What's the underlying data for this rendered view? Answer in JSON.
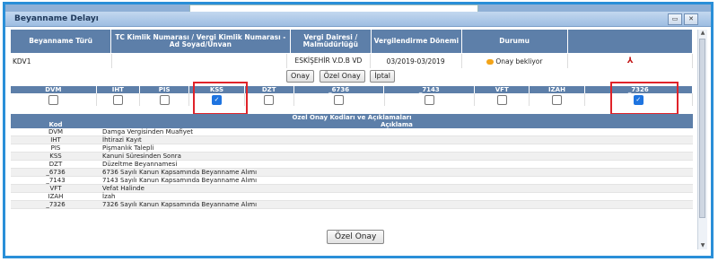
{
  "window": {
    "title": "Beyanname Delayı",
    "btn_min": "▭",
    "btn_close": "✕"
  },
  "header_cols": [
    "Beyanname Türü",
    "TC Kimlik Numarası / Vergi Kimlik Numarası - Ad Soyad/Unvan",
    "Vergi Dairesi / Malmüdürlüğü",
    "Vergilendirme Dönemi",
    "Durumu",
    ""
  ],
  "row": {
    "tur": "KDV1",
    "kimlik": "",
    "daire": "ESKİŞEHİR V.D.B VD",
    "donem": "03/2019-03/2019",
    "durum": "Onay bekliyor"
  },
  "actions": {
    "onay": "Onay",
    "ozel_onay": "Özel Onay",
    "iptal": "İptal"
  },
  "codes_header": [
    "DVM",
    "IHT",
    "PIS",
    "KSS",
    "DZT",
    "_6736",
    "_7143",
    "VFT",
    "IZAH",
    "_7326"
  ],
  "checked": [
    false,
    false,
    false,
    true,
    false,
    false,
    false,
    false,
    false,
    true
  ],
  "codes_table_title": "Özel Onay Kodları ve Açıklamaları",
  "codes_col_kod": "Kod",
  "codes_col_aciklama": "Açıklama",
  "codes": [
    {
      "kod": "DVM",
      "aciklama": "Damga Vergisinden Muafiyet"
    },
    {
      "kod": "IHT",
      "aciklama": "İhtirazi Kayıt"
    },
    {
      "kod": "PIS",
      "aciklama": "Pişmanlık Talepli"
    },
    {
      "kod": "KSS",
      "aciklama": "Kanuni Süresinden Sonra"
    },
    {
      "kod": "DZT",
      "aciklama": "Düzeltme Beyannamesi"
    },
    {
      "kod": "_6736",
      "aciklama": "6736 Sayılı Kanun Kapsamında Beyanname Alımı"
    },
    {
      "kod": "_7143",
      "aciklama": "7143 Sayılı Kanun Kapsamında Beyanname Alımı"
    },
    {
      "kod": "VFT",
      "aciklama": "Vefat Halinde"
    },
    {
      "kod": "IZAH",
      "aciklama": "İzah"
    },
    {
      "kod": "_7326",
      "aciklama": "7326 Sayılı Kanun Kapsamında Beyanname Alımı"
    }
  ],
  "bottom_button": "Özel Onay",
  "colors": {
    "header": "#5d7fa9",
    "highlight": "#e0232a",
    "frame": "#2a8fd8"
  }
}
